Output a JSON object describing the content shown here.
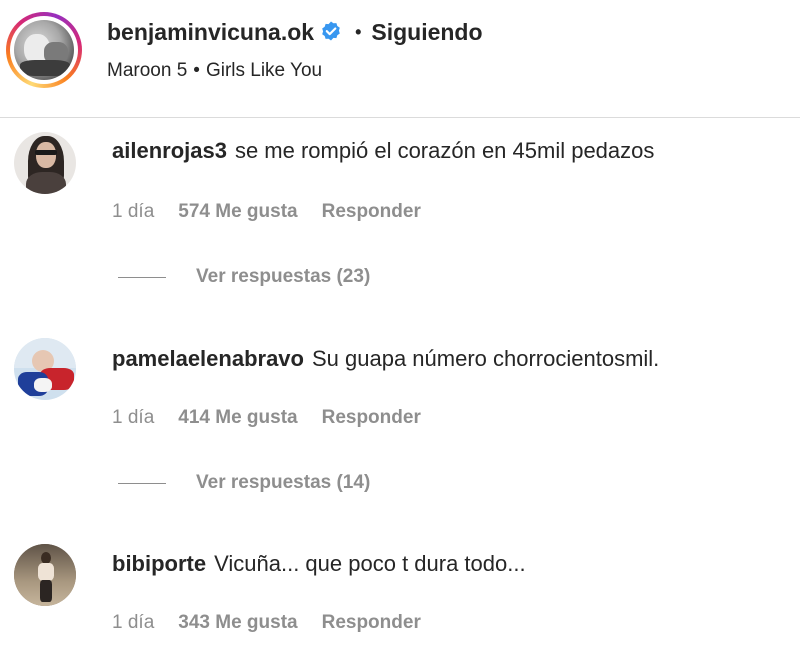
{
  "post": {
    "username": "benjaminvicuna.ok",
    "separator": "•",
    "follow_status": "Siguiendo",
    "song_artist": "Maroon 5",
    "song_separator": "•",
    "song_title": "Girls Like You"
  },
  "comments": [
    {
      "username": "ailenrojas3",
      "text": "se me rompió el corazón en 45mil pedazos",
      "time": "1 día",
      "likes": "574 Me gusta",
      "reply_label": "Responder",
      "view_replies": "Ver respuestas (23)"
    },
    {
      "username": "pamelaelenabravo",
      "text": "Su guapa número chorrocientosmil.",
      "time": "1 día",
      "likes": "414 Me gusta",
      "reply_label": "Responder",
      "view_replies": "Ver respuestas (14)"
    },
    {
      "username": "bibiporte",
      "text": "Vicuña... que poco t dura todo...",
      "time": "1 día",
      "likes": "343 Me gusta",
      "reply_label": "Responder"
    }
  ],
  "colors": {
    "verified_badge": "#3897f0",
    "secondary_text": "#8e8e8e",
    "primary_text": "#262626"
  }
}
